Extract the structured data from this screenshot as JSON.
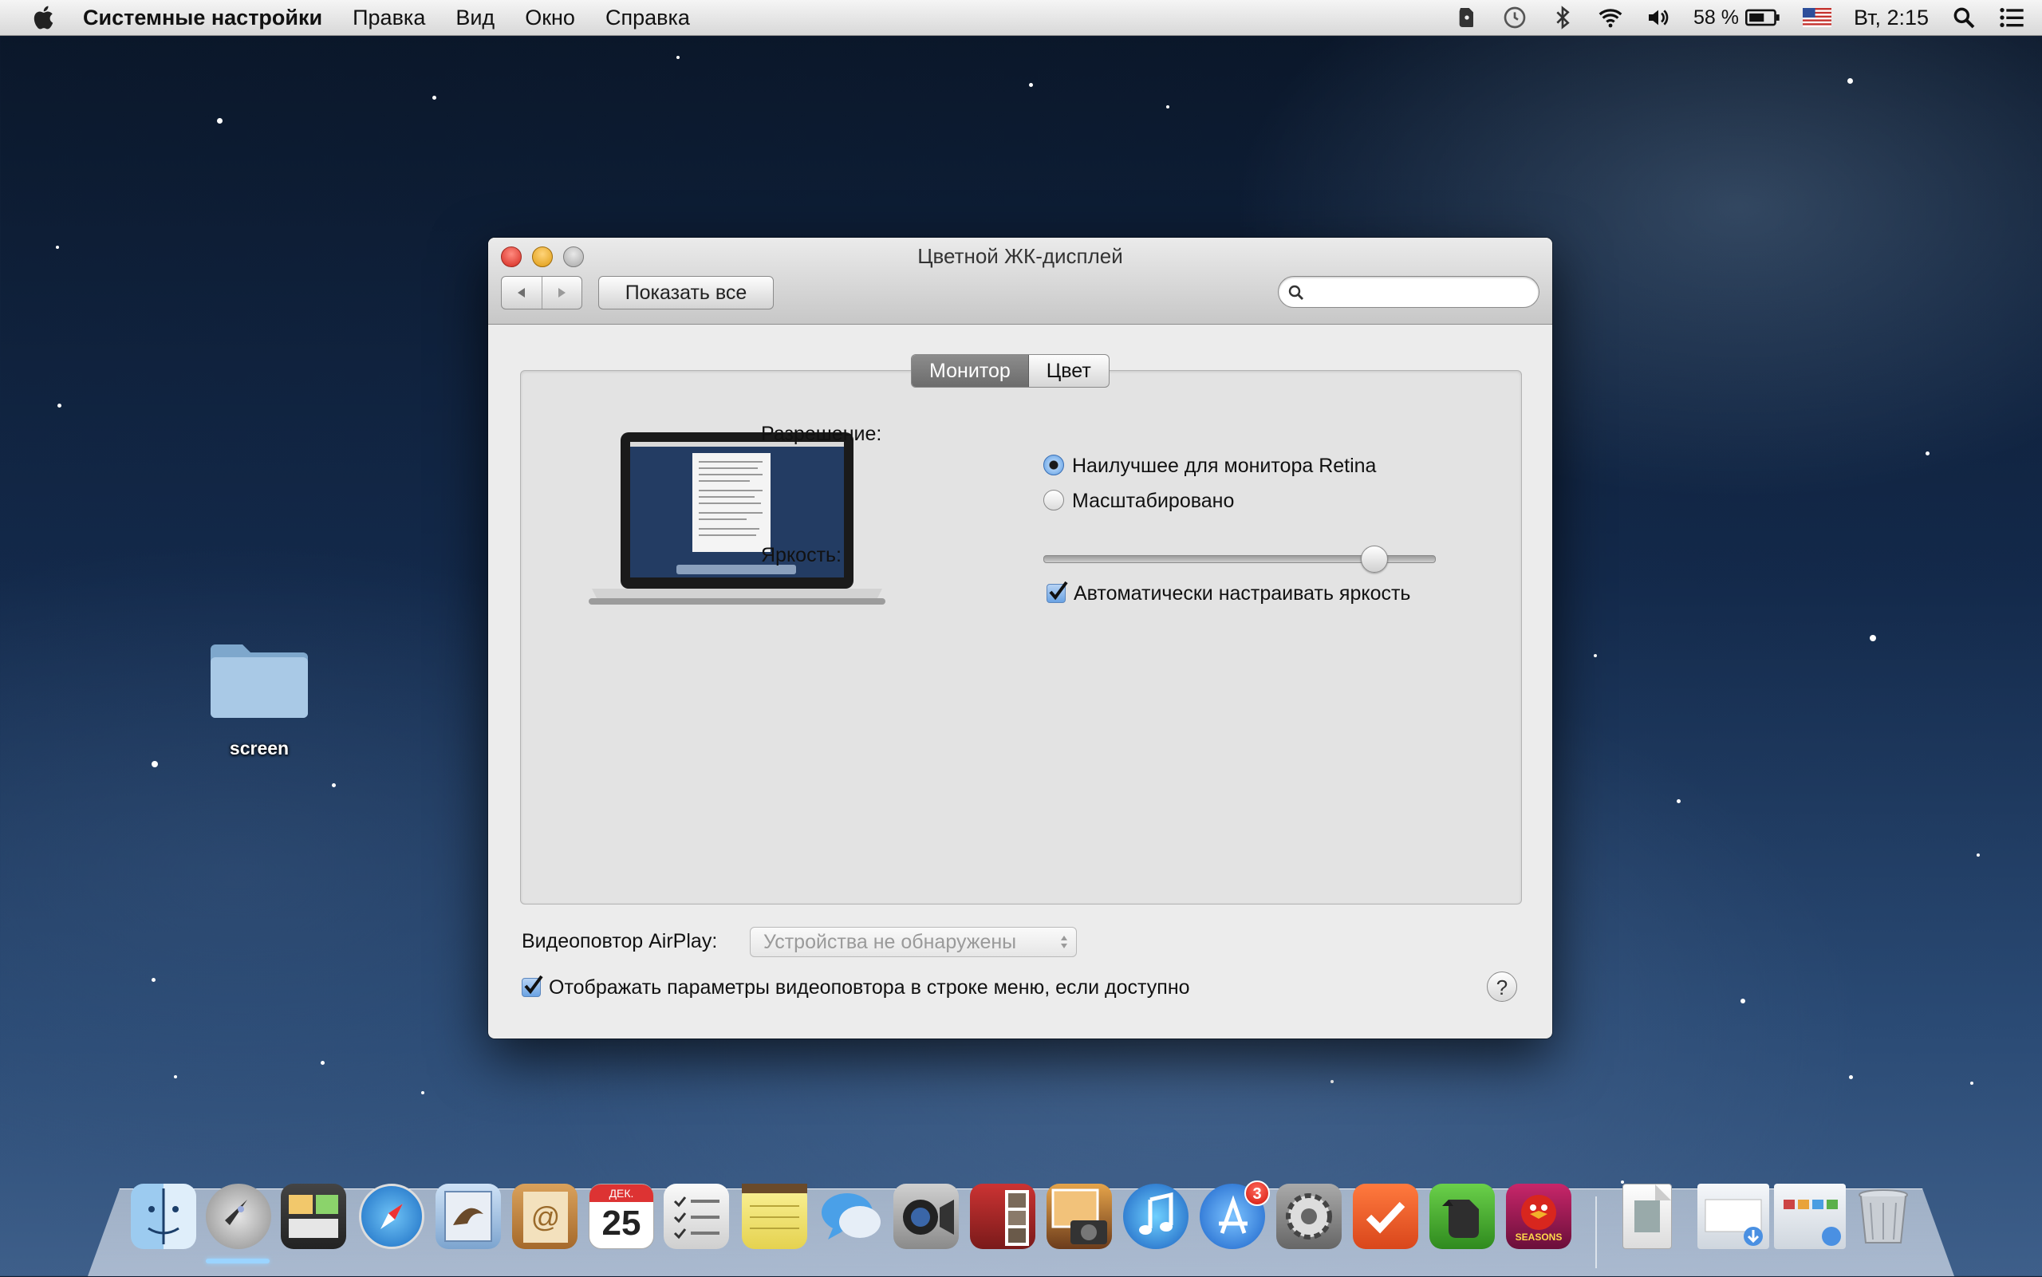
{
  "menubar": {
    "app_name": "Системные настройки",
    "items": [
      "Правка",
      "Вид",
      "Окно",
      "Справка"
    ],
    "battery": "58 %",
    "clock": "Вт, 2:15",
    "status_icons": [
      "evernote-icon",
      "time-machine-icon",
      "bluetooth-icon",
      "wifi-icon",
      "volume-icon",
      "battery-icon",
      "us-flag-icon",
      "spotlight-icon",
      "list-icon"
    ]
  },
  "window": {
    "title": "Цветной ЖК-дисплей",
    "show_all": "Показать все",
    "search_placeholder": "",
    "tabs": [
      "Монитор",
      "Цвет"
    ],
    "active_tab": "Монитор",
    "resolution_label": "Разрешение:",
    "resolution_options": [
      "Наилучшее для монитора Retina",
      "Масштабировано"
    ],
    "resolution_selected": "Наилучшее для монитора Retina",
    "brightness_label": "Яркость:",
    "brightness_level": 0.87,
    "auto_brightness_label": "Автоматически настраивать яркость",
    "auto_brightness_checked": true,
    "airplay_label": "Видеоповтор AirPlay:",
    "airplay_value": "Устройства не обнаружены",
    "mirroring_label": "Отображать параметры видеоповтора в строке меню, если доступно",
    "mirroring_checked": true,
    "help": "?"
  },
  "desktop": {
    "folder_label": "screen"
  },
  "dock": {
    "calendar_month": "ДЕК.",
    "calendar_day": "25",
    "appstore_badge": "3",
    "apps": [
      "finder",
      "launchpad",
      "dashboard",
      "safari",
      "mail",
      "contacts",
      "calendar",
      "reminders",
      "notes",
      "messages",
      "facetime",
      "photo-booth",
      "iphoto",
      "itunes",
      "app-store",
      "system-preferences",
      "wunderlist",
      "evernote",
      "angry-birds-seasons",
      "documents",
      "downloads",
      "applications",
      "trash"
    ],
    "angry_birds_label": "SEASONS"
  },
  "colors": {
    "accent": "#3a6fb5",
    "close": "#d4281e",
    "minimize": "#de9b12"
  }
}
